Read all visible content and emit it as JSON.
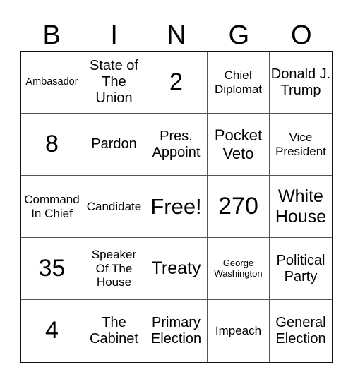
{
  "header": {
    "letters": [
      "B",
      "I",
      "N",
      "G",
      "O"
    ]
  },
  "board": {
    "rows": [
      [
        "Ambasador",
        "State of The Union",
        "2",
        "Chief Diplomat",
        "Donald J. Trump"
      ],
      [
        "8",
        "Pardon",
        "Pres. Appoint",
        "Pocket Veto",
        "Vice President"
      ],
      [
        "Command In Chief",
        "Candidate",
        "Free!",
        "270",
        "White House"
      ],
      [
        "35",
        "Speaker Of The House",
        "Treaty",
        "George Washington",
        "Political Party"
      ],
      [
        "4",
        "The Cabinet",
        "Primary Election",
        "Impeach",
        "General Election"
      ]
    ],
    "free_space": "Free!"
  }
}
